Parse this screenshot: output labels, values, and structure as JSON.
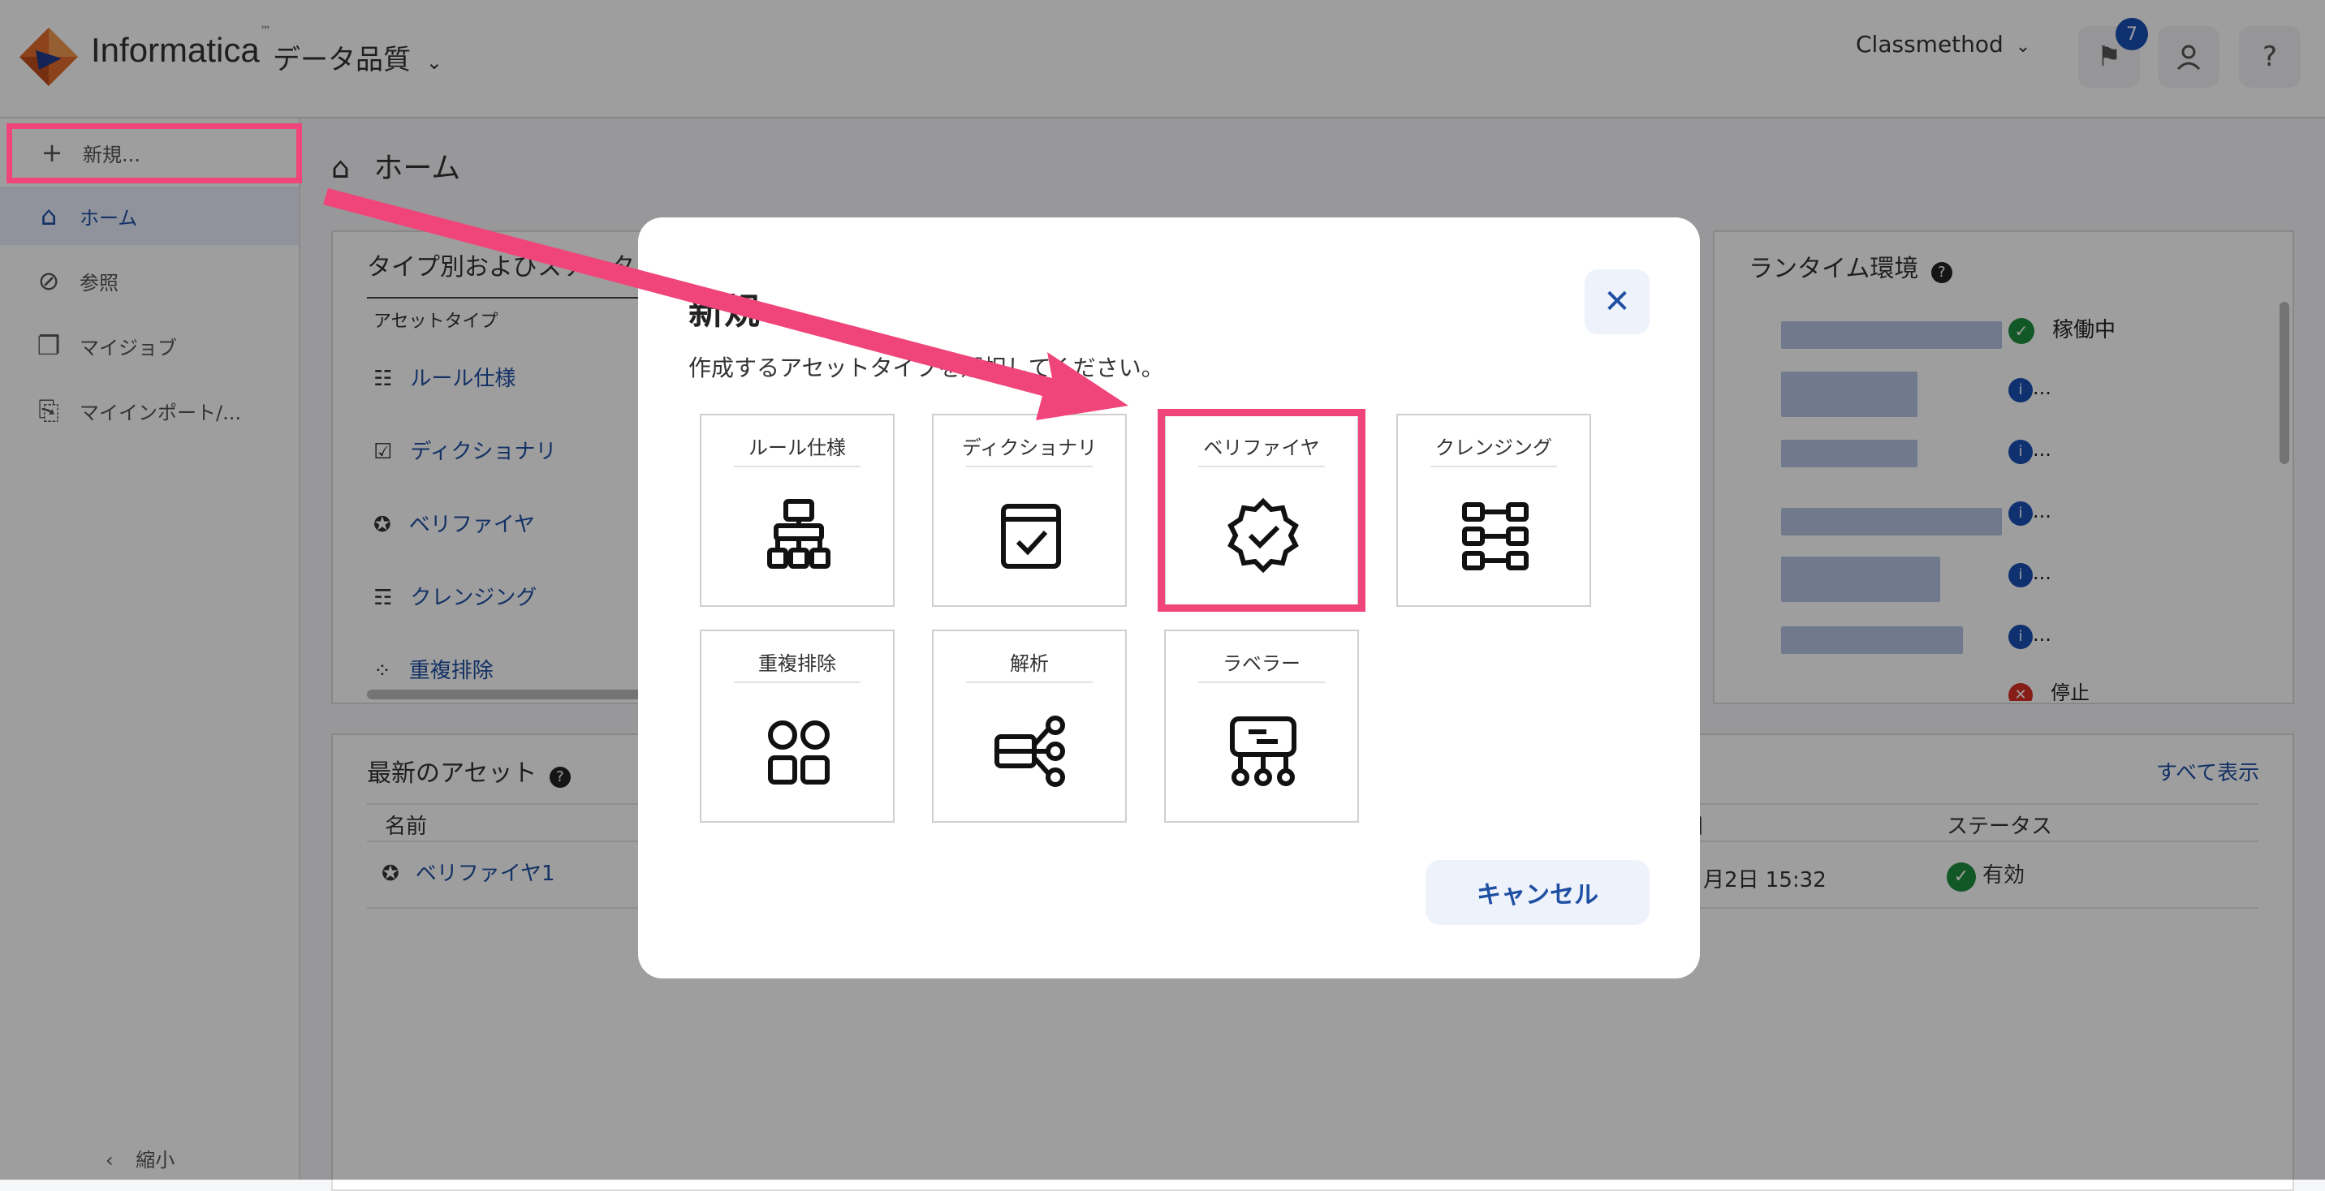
{
  "header": {
    "brand": "Informatica",
    "product": "データ品質",
    "org": "Classmethod",
    "notification_count": "7",
    "help": "?"
  },
  "sidebar": {
    "new_label": "新規...",
    "items": [
      {
        "label": "ホーム",
        "active": true
      },
      {
        "label": "参照"
      },
      {
        "label": "マイジョブ"
      },
      {
        "label": "マイインポート/..."
      }
    ],
    "collapse_label": "縮小"
  },
  "main": {
    "breadcrumb": "ホーム",
    "type_card": {
      "title": "タイプ別およびステータ",
      "column": "アセットタイプ",
      "rows": [
        "ルール仕様",
        "ディクショナリ",
        "ベリファイヤ",
        "クレンジング",
        "重複排除"
      ]
    },
    "runtime_card": {
      "title": "ランタイム環境",
      "statuses": [
        "稼働中",
        "...",
        "...",
        "...",
        "...",
        "...",
        "停止"
      ]
    },
    "recent_card": {
      "title": "最新のアセット",
      "show_all": "すべて表示",
      "columns": [
        "名前",
        "日",
        "ステータス"
      ],
      "rows": [
        {
          "name": "ベリファイヤ1",
          "date": "月2日 15:32",
          "status": "有効"
        }
      ]
    }
  },
  "modal": {
    "title": "新規",
    "description": "作成するアセットタイプを選択してください。",
    "tiles": [
      {
        "label": "ルール仕様",
        "icon": "rule-spec-icon"
      },
      {
        "label": "ディクショナリ",
        "icon": "dictionary-icon"
      },
      {
        "label": "ベリファイヤ",
        "icon": "verifier-icon",
        "highlighted": true
      },
      {
        "label": "クレンジング",
        "icon": "cleanse-icon"
      },
      {
        "label": "重複排除",
        "icon": "dedup-icon"
      },
      {
        "label": "解析",
        "icon": "parse-icon"
      },
      {
        "label": "ラベラー",
        "icon": "labeler-icon"
      }
    ],
    "cancel_label": "キャンセル"
  },
  "colors": {
    "accent": "#1f4fa3",
    "highlight": "#f0457a",
    "success": "#1e8e3e",
    "error": "#d93025"
  }
}
